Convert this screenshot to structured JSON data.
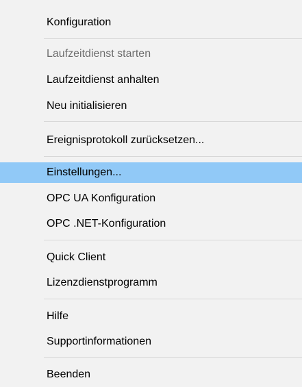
{
  "menu": {
    "items": [
      {
        "label": "Konfiguration",
        "state": "normal"
      },
      {
        "label": "Laufzeitdienst starten",
        "state": "disabled"
      },
      {
        "label": "Laufzeitdienst anhalten",
        "state": "normal"
      },
      {
        "label": "Neu initialisieren",
        "state": "normal"
      },
      {
        "label": "Ereignisprotokoll zurücksetzen...",
        "state": "normal"
      },
      {
        "label": "Einstellungen...",
        "state": "highlighted"
      },
      {
        "label": "OPC UA Konfiguration",
        "state": "normal"
      },
      {
        "label": "OPC .NET-Konfiguration",
        "state": "normal"
      },
      {
        "label": "Quick Client",
        "state": "normal"
      },
      {
        "label": "Lizenzdienstprogramm",
        "state": "normal"
      },
      {
        "label": "Hilfe",
        "state": "normal"
      },
      {
        "label": "Supportinformationen",
        "state": "normal"
      },
      {
        "label": "Beenden",
        "state": "normal"
      }
    ]
  },
  "colors": {
    "menu_background": "#f2f2f2",
    "highlight": "#91c9f7",
    "disabled_text": "#6d6d6d",
    "separator": "#d7d7d7"
  }
}
